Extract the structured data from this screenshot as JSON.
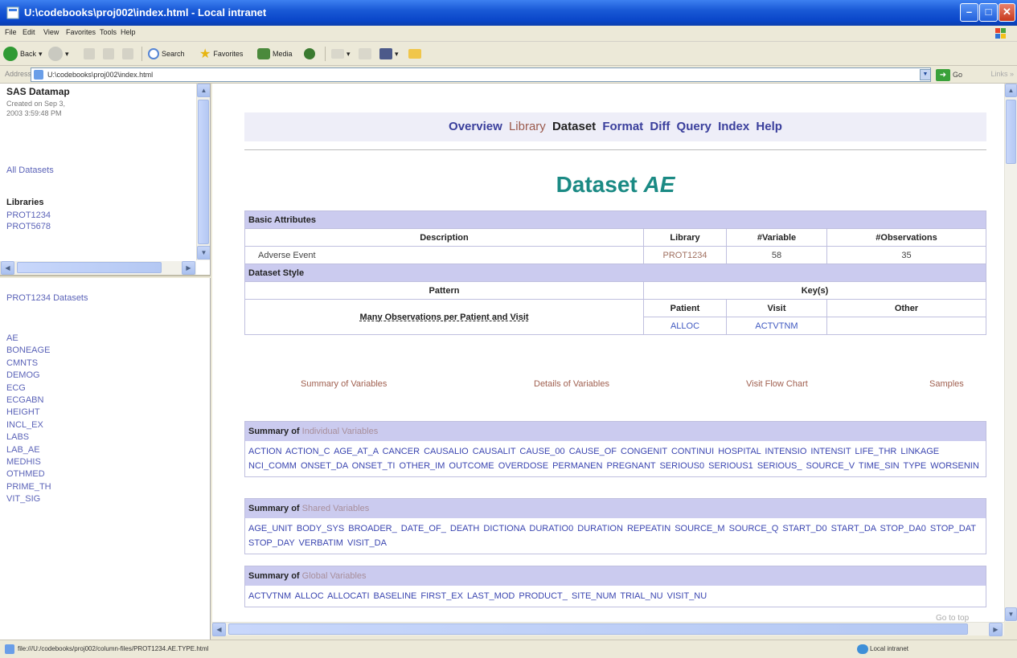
{
  "window": {
    "title": "U:\\codebooks\\proj002\\index.html - Local intranet",
    "controls": [
      "minimize",
      "maximize",
      "close"
    ]
  },
  "menu": [
    "File",
    "Edit",
    "View",
    "Favorites",
    "Tools",
    "Help"
  ],
  "toolbar": {
    "back_label": "Back",
    "search_label": "Search",
    "favorites_label": "Favorites",
    "media_label": "Media"
  },
  "address": {
    "label": "Address",
    "url": "U:\\codebooks\\proj002\\index.html",
    "go_label": "Go",
    "links_label": "Links"
  },
  "left_top": {
    "title": "SAS Datamap",
    "created": "Created on Sep 3, 2003 3:59:48 PM",
    "all_datasets": "All Datasets",
    "libraries_heading": "Libraries",
    "libraries": [
      "PROT1234",
      "PROT5678"
    ]
  },
  "left_bottom": {
    "heading": "PROT1234 Datasets",
    "datasets": [
      "AE",
      "BONEAGE",
      "CMNTS",
      "DEMOG",
      "ECG",
      "ECGABN",
      "HEIGHT",
      "INCL_EX",
      "LABS",
      "LAB_AE",
      "MEDHIS",
      "OTHMED",
      "PRIME_TH",
      "VIT_SIG"
    ]
  },
  "nav": {
    "overview": "Overview",
    "library": "Library",
    "dataset": "Dataset",
    "format": "Format",
    "diff": "Diff",
    "query": "Query",
    "index": "Index",
    "help": "Help"
  },
  "page": {
    "title_prefix": "Dataset",
    "title_name": "AE"
  },
  "basic_attributes": {
    "section": "Basic Attributes",
    "headers": {
      "description": "Description",
      "library": "Library",
      "variables": "#Variable",
      "observations": "#Observations"
    },
    "row": {
      "description": "Adverse Event",
      "library": "PROT1234",
      "variables": "58",
      "observations": "35"
    }
  },
  "dataset_style": {
    "section": "Dataset Style",
    "pattern_header": "Pattern",
    "keys_header": "Key(s)",
    "key_headers": {
      "patient": "Patient",
      "visit": "Visit",
      "other": "Other"
    },
    "pattern": "Many Observations per Patient and Visit",
    "keys": {
      "patient": "ALLOC",
      "visit": "ACTVTNM",
      "other": ""
    }
  },
  "subnav": {
    "summary": "Summary of Variables",
    "details": "Details of Variables",
    "visit_flow": "Visit Flow Chart",
    "samples": "Samples"
  },
  "summaries": {
    "prefix": "Summary of",
    "individual": {
      "heading": "Individual Variables",
      "text": "ACTION ACTION_C AGE_AT_A CANCER CAUSALIO CAUSALIT CAUSE_00 CAUSE_OF CONGENIT CONTINUI HOSPITAL INTENSIO INTENSIT LIFE_THR LINKAGE NCI_COMM ONSET_DA ONSET_TI OTHER_IM OUTCOME OVERDOSE PERMANEN PREGNANT SERIOUS0 SERIOUS1 SERIOUS_ SOURCE_V TIME_SIN TYPE WORSENIN"
    },
    "shared": {
      "heading": "Shared Variables",
      "text": "AGE_UNIT BODY_SYS BROADER_ DATE_OF_ DEATH DICTIONA DURATIO0 DURATION REPEATIN SOURCE_M SOURCE_Q START_D0 START_DA STOP_DA0 STOP_DAT STOP_DAY VERBATIM VISIT_DA"
    },
    "global": {
      "heading": "Global Variables",
      "text": "ACTVTNM ALLOC ALLOCATI BASELINE FIRST_EX LAST_MOD PRODUCT_ SITE_NUM TRIAL_NU VISIT_NU"
    }
  },
  "goto_top": "Go to top",
  "status": {
    "url": "file:///U:/codebooks/proj002/column-files/PROT1234.AE.TYPE.html",
    "zone": "Local intranet"
  }
}
